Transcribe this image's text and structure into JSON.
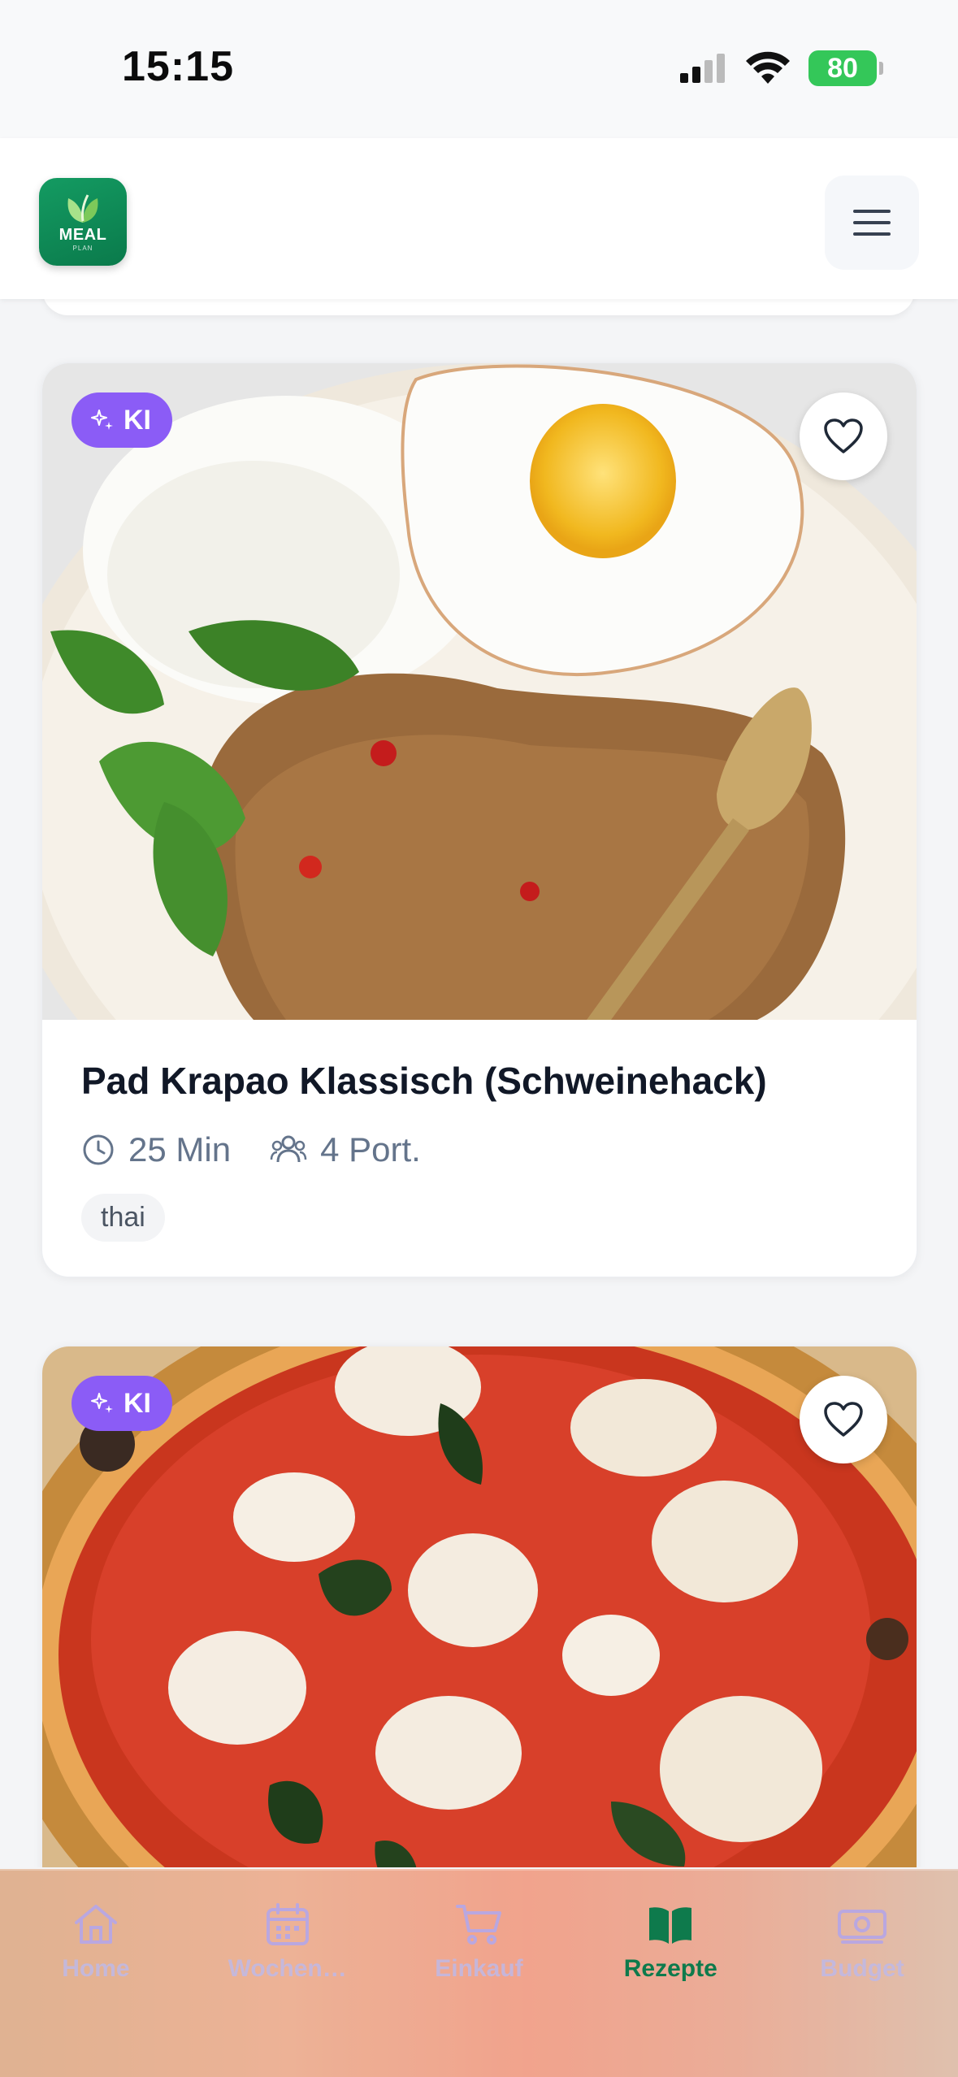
{
  "status_bar": {
    "time": "15:15",
    "battery": "80"
  },
  "header": {
    "logo_text": "MEAL",
    "logo_sub": "PLAN",
    "menu_icon": "hamburger-menu-icon"
  },
  "recipes": [
    {
      "badge": "KI",
      "title": "Pad Krapao Klassisch (Schweinehack)",
      "time": "25 Min",
      "portions": "4 Port.",
      "tag": "thai",
      "image": "thai-basil-pork-rice-egg"
    },
    {
      "badge": "KI",
      "image": "pizza-margherita"
    }
  ],
  "bottom_nav": {
    "items": [
      {
        "label": "Home",
        "icon": "home-icon"
      },
      {
        "label": "Wochen…",
        "icon": "calendar-icon"
      },
      {
        "label": "Einkauf",
        "icon": "cart-icon"
      },
      {
        "label": "Rezepte",
        "icon": "book-icon",
        "active": true
      },
      {
        "label": "Budget",
        "icon": "money-icon"
      }
    ]
  },
  "colors": {
    "accent": "#0e7a4c",
    "ki_badge": "#8b5cf6",
    "text_muted": "#64748b"
  }
}
